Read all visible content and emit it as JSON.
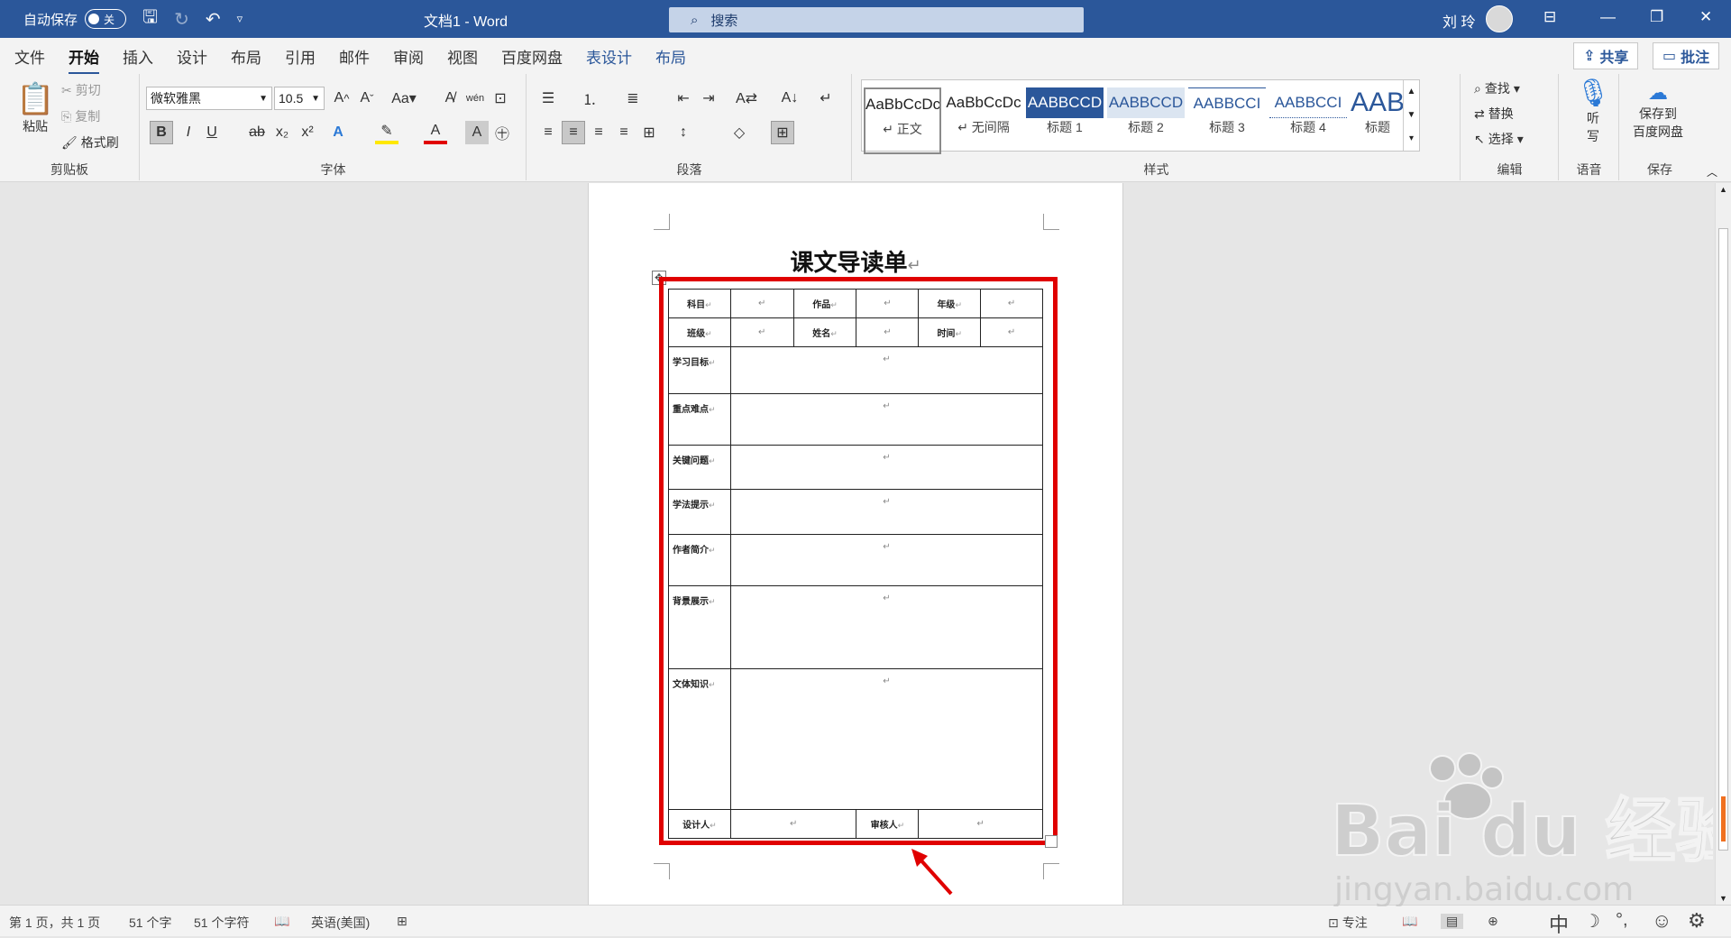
{
  "titlebar": {
    "autosave_label": "自动保存",
    "autosave_state": "关",
    "doc_title": "文档1  -  Word",
    "search_placeholder": "搜索",
    "user_name": "刘 玲"
  },
  "ribbon_tabs": [
    "文件",
    "开始",
    "插入",
    "设计",
    "布局",
    "引用",
    "邮件",
    "审阅",
    "视图",
    "百度网盘",
    "表设计",
    "布局"
  ],
  "ribbon_actions": {
    "share": "共享",
    "comment": "批注"
  },
  "clipboard": {
    "paste": "粘贴",
    "cut": "剪切",
    "copy": "复制",
    "format_painter": "格式刷",
    "label": "剪贴板"
  },
  "font": {
    "family": "微软雅黑",
    "size": "10.5",
    "label": "字体"
  },
  "paragraph": {
    "label": "段落"
  },
  "styles": {
    "label": "样式",
    "items": [
      {
        "sample": "AaBbCcDc",
        "name": "↵ 正文"
      },
      {
        "sample": "AaBbCcDc",
        "name": "↵ 无间隔"
      },
      {
        "sample": "AABBCCD",
        "name": "标题 1"
      },
      {
        "sample": "AABBCCD",
        "name": "标题 2"
      },
      {
        "sample": "AABBCCI",
        "name": "标题 3"
      },
      {
        "sample": "AABBCCI",
        "name": "标题 4"
      },
      {
        "sample": "AAB",
        "name": "标题"
      }
    ]
  },
  "editing": {
    "find": "查找",
    "replace": "替换",
    "select": "选择",
    "label": "编辑"
  },
  "voice": {
    "dictate": "听写",
    "label": "语音"
  },
  "save": {
    "save_to": "保存到",
    "save_to2": "百度网盘",
    "label": "保存"
  },
  "document": {
    "heading": "课文导读单",
    "row1": [
      "科目",
      "作品",
      "年级"
    ],
    "row2": [
      "班级",
      "姓名",
      "时间"
    ],
    "sections": [
      "学习目标",
      "重点难点",
      "关键问题",
      "学法提示",
      "作者简介",
      "背景展示",
      "文体知识"
    ],
    "footer": [
      "设计人",
      "审核人"
    ],
    "para_mark": "↵"
  },
  "statusbar": {
    "page": "第 1 页，共 1 页",
    "words": "51 个字",
    "chars": "51 个字符",
    "language": "英语(美国)",
    "focus": "专注",
    "ime": [
      "中",
      "☽",
      "°,",
      "☺",
      "⚙"
    ]
  },
  "watermark": {
    "brand": "Bai du 经验",
    "url": "jingyan.baidu.com"
  },
  "colors": {
    "accent": "#2b579a",
    "highlight_frame": "#e00000"
  }
}
